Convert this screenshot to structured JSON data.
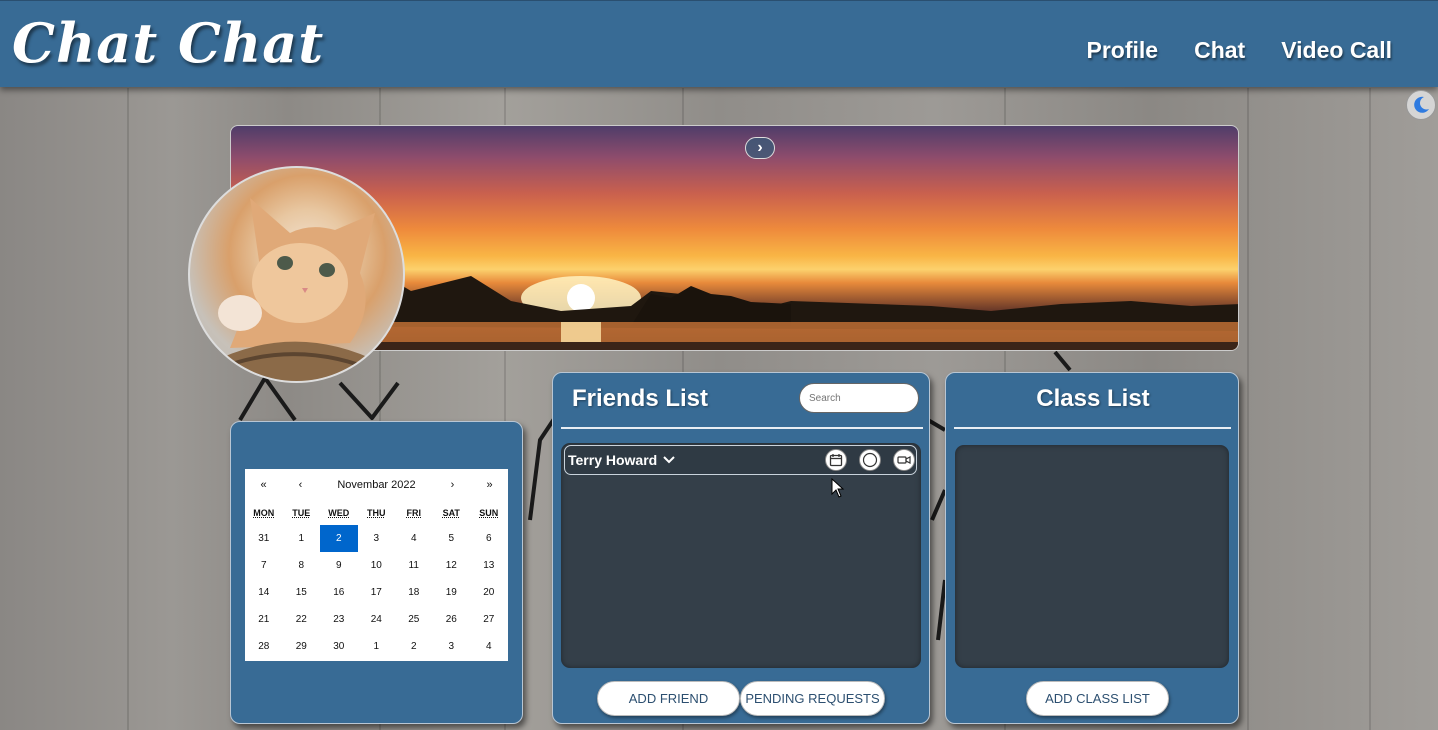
{
  "header": {
    "logo": "Chat Chat",
    "nav": [
      {
        "label": "Profile"
      },
      {
        "label": "Chat"
      },
      {
        "label": "Video Call"
      }
    ]
  },
  "theme_toggle": {
    "icon": "moon-icon"
  },
  "banner": {
    "next_icon": "chevron-right-icon",
    "next_label": "›"
  },
  "calendar": {
    "title": "Novembar 2022",
    "prev_year": "«",
    "prev_month": "‹",
    "next_month": "›",
    "next_year": "»",
    "weekdays": [
      "MON",
      "TUE",
      "WED",
      "THU",
      "FRI",
      "SAT",
      "SUN"
    ],
    "days": [
      [
        "31",
        "1",
        "2",
        "3",
        "4",
        "5",
        "6"
      ],
      [
        "7",
        "8",
        "9",
        "10",
        "11",
        "12",
        "13"
      ],
      [
        "14",
        "15",
        "16",
        "17",
        "18",
        "19",
        "20"
      ],
      [
        "21",
        "22",
        "23",
        "24",
        "25",
        "26",
        "27"
      ],
      [
        "28",
        "29",
        "30",
        "1",
        "2",
        "3",
        "4"
      ]
    ],
    "selected": "2"
  },
  "friends": {
    "title": "Friends List",
    "search_placeholder": "Search",
    "items": [
      {
        "name": "Terry Howard",
        "icons": [
          "calendar-icon",
          "chat-bubble-icon",
          "video-camera-icon"
        ]
      }
    ],
    "add_button": "ADD FRIEND",
    "pending_button": "PENDING REQUESTS"
  },
  "classes": {
    "title": "Class List",
    "add_button": "ADD CLASS LIST"
  },
  "colors": {
    "header": "#386b95",
    "panel": "#386b95",
    "list_box": "#343f49",
    "selected_day": "#0066cc"
  }
}
